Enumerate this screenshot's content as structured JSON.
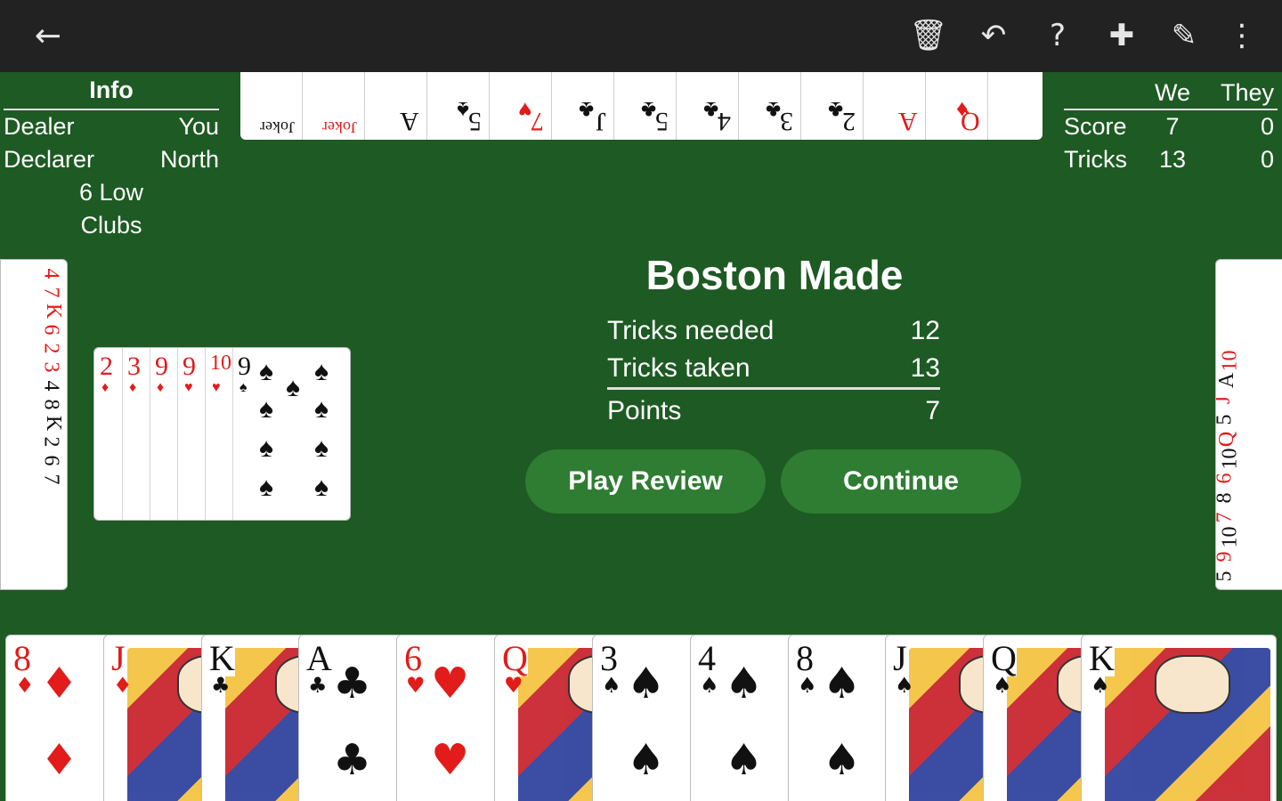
{
  "toolbar": {
    "back_icon": "←",
    "trash_icon": "🗑",
    "undo_icon": "↶",
    "help_icon": "?",
    "gamepad_icon": "✚",
    "scoresheet_icon": "✎",
    "more_icon": "⋮"
  },
  "info": {
    "header": "Info",
    "dealer_label": "Dealer",
    "dealer_value": "You",
    "declarer_label": "Declarer",
    "declarer_value": "North",
    "bid_line1": "6 Low",
    "bid_line2": "Clubs"
  },
  "score": {
    "col_we": "We",
    "col_they": "They",
    "score_label": "Score",
    "score_we": "7",
    "score_they": "0",
    "tricks_label": "Tricks",
    "tricks_we": "13",
    "tricks_they": "0"
  },
  "north_hand": [
    {
      "rank": "Joker",
      "suit": "",
      "color": "#111111"
    },
    {
      "rank": "Joker",
      "suit": "",
      "color": "#e21b1b"
    },
    {
      "rank": "A",
      "suit": "",
      "color": "#111111"
    },
    {
      "rank": "5",
      "suit": "♠",
      "color": "#111111"
    },
    {
      "rank": "7",
      "suit": "♥",
      "color": "#e21b1b"
    },
    {
      "rank": "J",
      "suit": "♣",
      "color": "#111111"
    },
    {
      "rank": "5",
      "suit": "♣",
      "color": "#111111"
    },
    {
      "rank": "4",
      "suit": "♣",
      "color": "#111111"
    },
    {
      "rank": "3",
      "suit": "♣",
      "color": "#111111"
    },
    {
      "rank": "2",
      "suit": "♣",
      "color": "#111111"
    },
    {
      "rank": "A",
      "suit": "",
      "color": "#e21b1b"
    },
    {
      "rank": "Q",
      "suit": "♦",
      "color": "#e21b1b"
    }
  ],
  "west_hand": [
    "4",
    "7",
    "K",
    "6",
    "2",
    "3",
    "4",
    "8",
    "K",
    "2",
    "6",
    "7"
  ],
  "east_hand": [
    "10",
    "A",
    "J",
    "5",
    "Q",
    "10",
    "6",
    "8",
    "7",
    "10",
    "9",
    "5"
  ],
  "trick_pile": [
    {
      "rank": "2",
      "color": "#e21b1b",
      "suit": "♦"
    },
    {
      "rank": "3",
      "color": "#e21b1b",
      "suit": "♦"
    },
    {
      "rank": "9",
      "color": "#e21b1b",
      "suit": "♦"
    },
    {
      "rank": "9",
      "color": "#e21b1b",
      "suit": "♥"
    },
    {
      "rank": "10",
      "color": "#e21b1b",
      "suit": "♥"
    },
    {
      "rank": "9",
      "color": "#111111",
      "suit": "♠"
    }
  ],
  "result": {
    "title": "Boston Made",
    "needed_label": "Tricks needed",
    "needed_value": "12",
    "taken_label": "Tricks taken",
    "taken_value": "13",
    "points_label": "Points",
    "points_value": "7",
    "review_button": "Play Review",
    "continue_button": "Continue"
  },
  "south_hand": [
    {
      "rank": "8",
      "suit": "♦",
      "color": "#e21b1b",
      "court": false
    },
    {
      "rank": "J",
      "suit": "♦",
      "color": "#e21b1b",
      "court": true
    },
    {
      "rank": "K",
      "suit": "♣",
      "color": "#111111",
      "court": true
    },
    {
      "rank": "A",
      "suit": "♣",
      "color": "#111111",
      "court": false
    },
    {
      "rank": "6",
      "suit": "♥",
      "color": "#e21b1b",
      "court": false
    },
    {
      "rank": "Q",
      "suit": "♥",
      "color": "#e21b1b",
      "court": true
    },
    {
      "rank": "3",
      "suit": "♠",
      "color": "#111111",
      "court": false
    },
    {
      "rank": "4",
      "suit": "♠",
      "color": "#111111",
      "court": false
    },
    {
      "rank": "8",
      "suit": "♠",
      "color": "#111111",
      "court": false
    },
    {
      "rank": "J",
      "suit": "♠",
      "color": "#111111",
      "court": true
    },
    {
      "rank": "Q",
      "suit": "♠",
      "color": "#111111",
      "court": true
    },
    {
      "rank": "K",
      "suit": "♠",
      "color": "#111111",
      "court": true
    }
  ]
}
